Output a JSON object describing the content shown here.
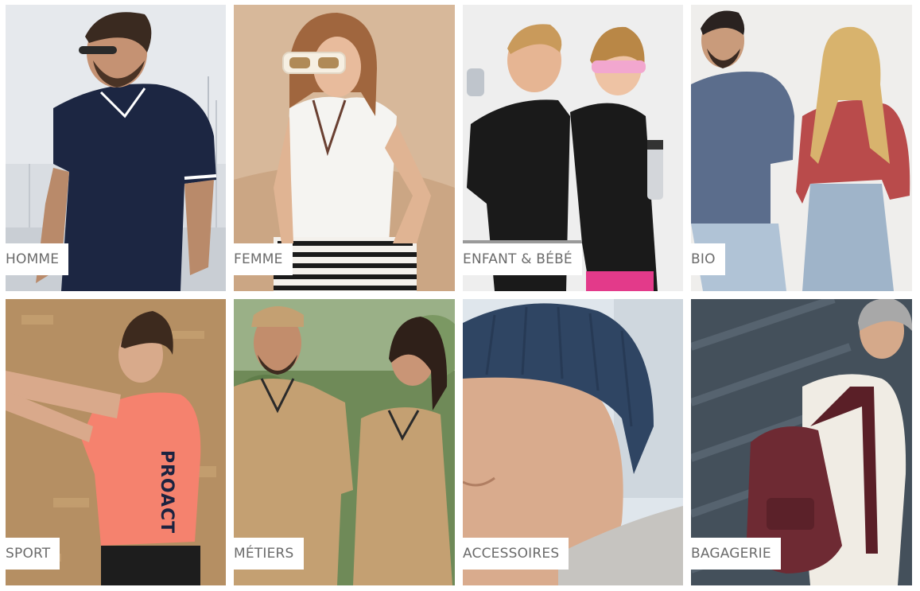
{
  "categories": [
    {
      "label": "HOMME"
    },
    {
      "label": "FEMME"
    },
    {
      "label": "ENFANT & BÉBÉ"
    },
    {
      "label": "BIO"
    },
    {
      "label": "SPORT"
    },
    {
      "label": "MÉTIERS"
    },
    {
      "label": "ACCESSOIRES"
    },
    {
      "label": "BAGAGERIE"
    }
  ],
  "print_text": {
    "sport_shirt": "PROACT"
  },
  "colors": {
    "label_background": "#ffffff",
    "label_text": "#6b6b6b",
    "homme_polo": "#1c2642",
    "femme_sand": "#d7b89a",
    "enfant_background": "#eeeeee",
    "bio_sweat_blue": "#5b6d8c",
    "bio_sweat_red": "#b94b4b",
    "sport_shirt": "#f5826e",
    "metiers_polo": "#c4a072",
    "accessoires_beanie": "#2f4563",
    "bagagerie_backpack": "#6e2a33"
  },
  "icons": [
    "product-photo"
  ]
}
